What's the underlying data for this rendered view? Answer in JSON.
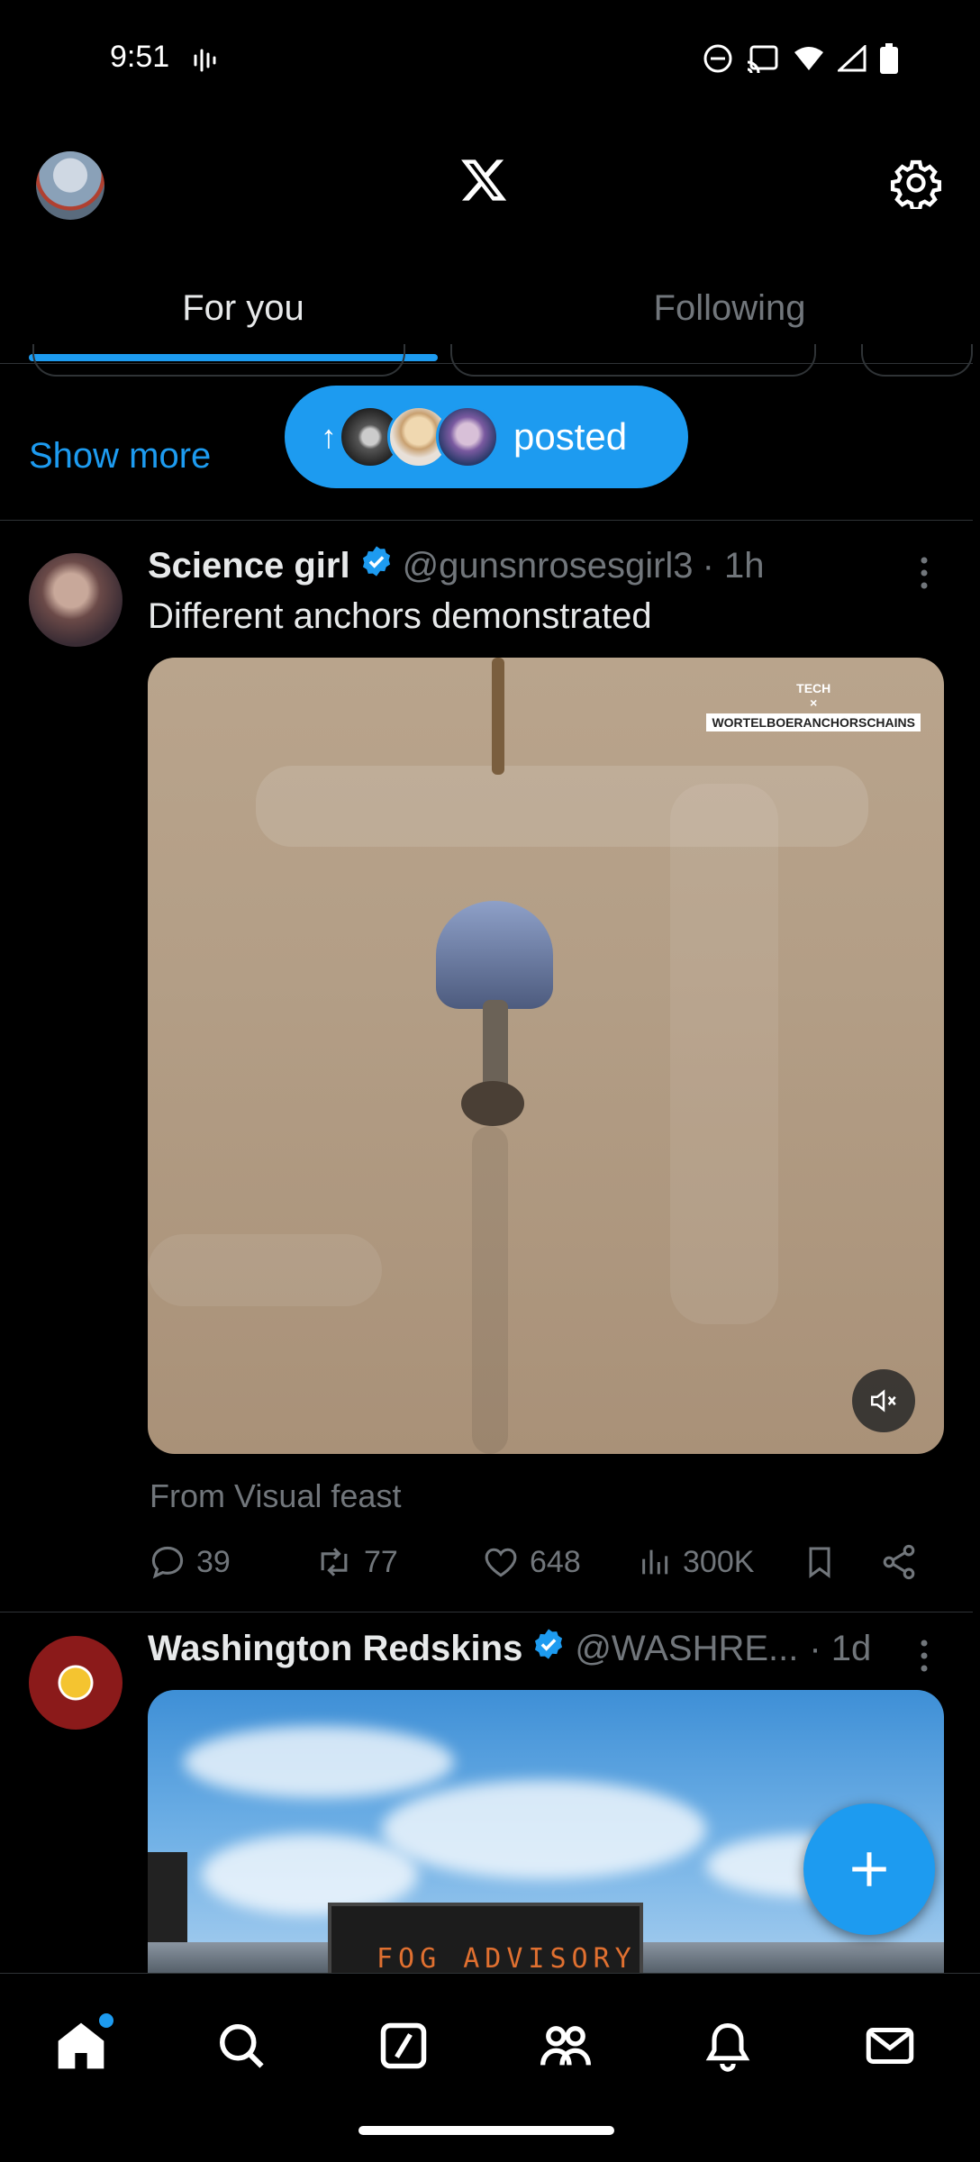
{
  "status_bar": {
    "time": "9:51"
  },
  "header": {
    "logo_icon": "x-logo-icon",
    "settings_icon": "gear-icon"
  },
  "tabs": [
    {
      "label": "For you",
      "active": true
    },
    {
      "label": "Following",
      "active": false
    }
  ],
  "new_posts": {
    "show_more": "Show more",
    "pill_label": "posted"
  },
  "tweets": [
    {
      "name": "Science girl",
      "verified": true,
      "handle": "@gunsnrosesgirl3",
      "time": "· 1h",
      "text": "Different anchors demonstrated",
      "watermark_top": "TECH",
      "watermark_x": "×",
      "watermark_box": "WORTELBOERANCHORSCHAINS",
      "from": "From Visual feast",
      "stats": {
        "replies": "39",
        "reposts": "77",
        "likes": "648",
        "views": "300K"
      }
    },
    {
      "name": "Washington Redskins",
      "verified": true,
      "handle": "@WASHRE...",
      "time": "· 1d",
      "sign_text": "FOG ADVISORY"
    }
  ],
  "colors": {
    "accent": "#1d9bf0",
    "background": "#000000",
    "text_primary": "#e7e9ea",
    "text_secondary": "#71767b"
  }
}
